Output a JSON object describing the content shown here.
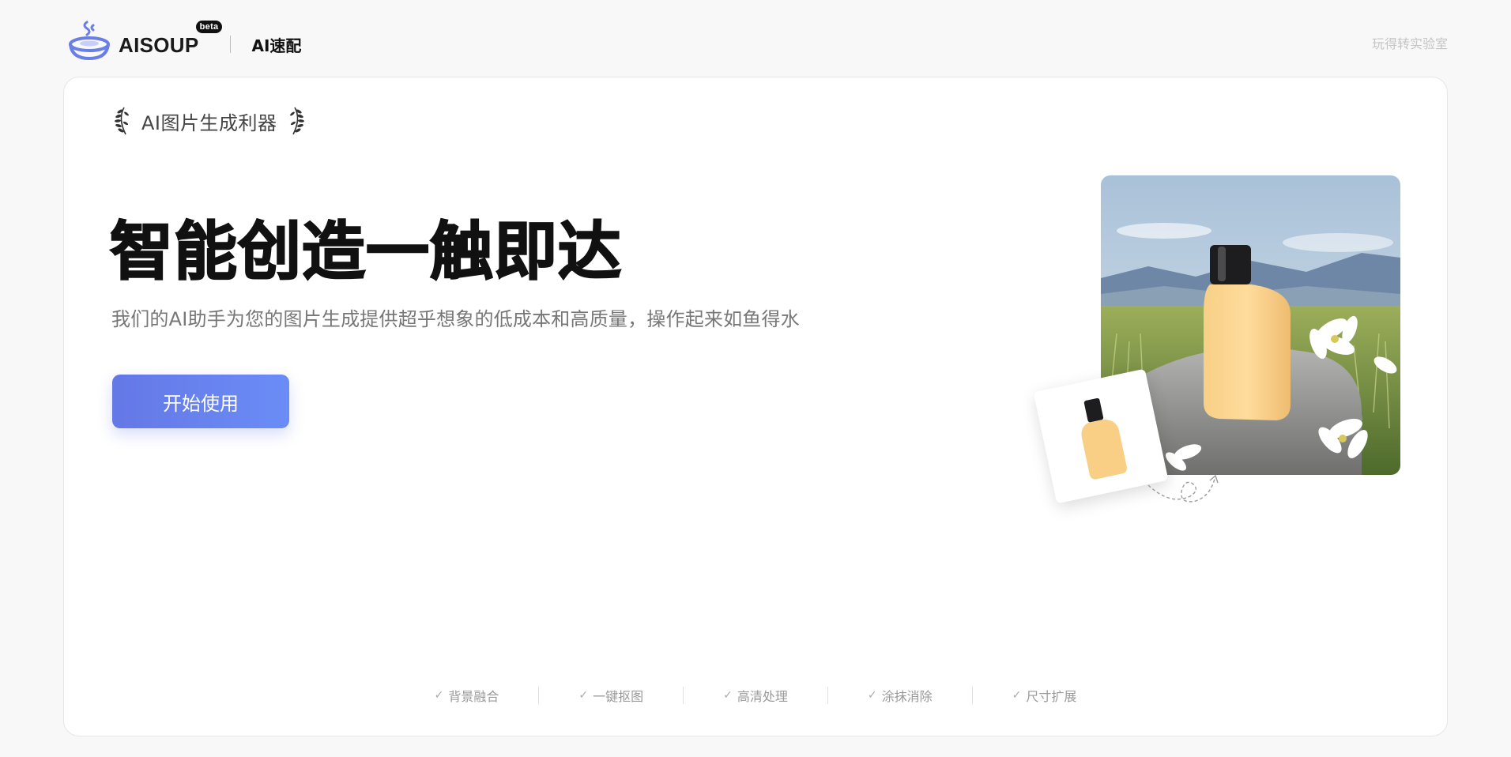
{
  "header": {
    "brand": "AISOUP",
    "badge": "beta",
    "product": "AI速配",
    "lab_link": "玩得转实验室",
    "accent_color": "#6a7fe6"
  },
  "hero": {
    "award_text": "AI图片生成利器",
    "title": "智能创造一触即达",
    "subtitle": "我们的AI助手为您的图片生成提供超乎想象的低成本和高质量，操作起来如鱼得水",
    "cta_label": "开始使用"
  },
  "features": [
    {
      "label": "背景融合",
      "icon": "check-icon"
    },
    {
      "label": "一键抠图",
      "icon": "check-icon"
    },
    {
      "label": "高清处理",
      "icon": "check-icon"
    },
    {
      "label": "涂抹消除",
      "icon": "check-icon"
    },
    {
      "label": "尺寸扩展",
      "icon": "check-icon"
    }
  ]
}
